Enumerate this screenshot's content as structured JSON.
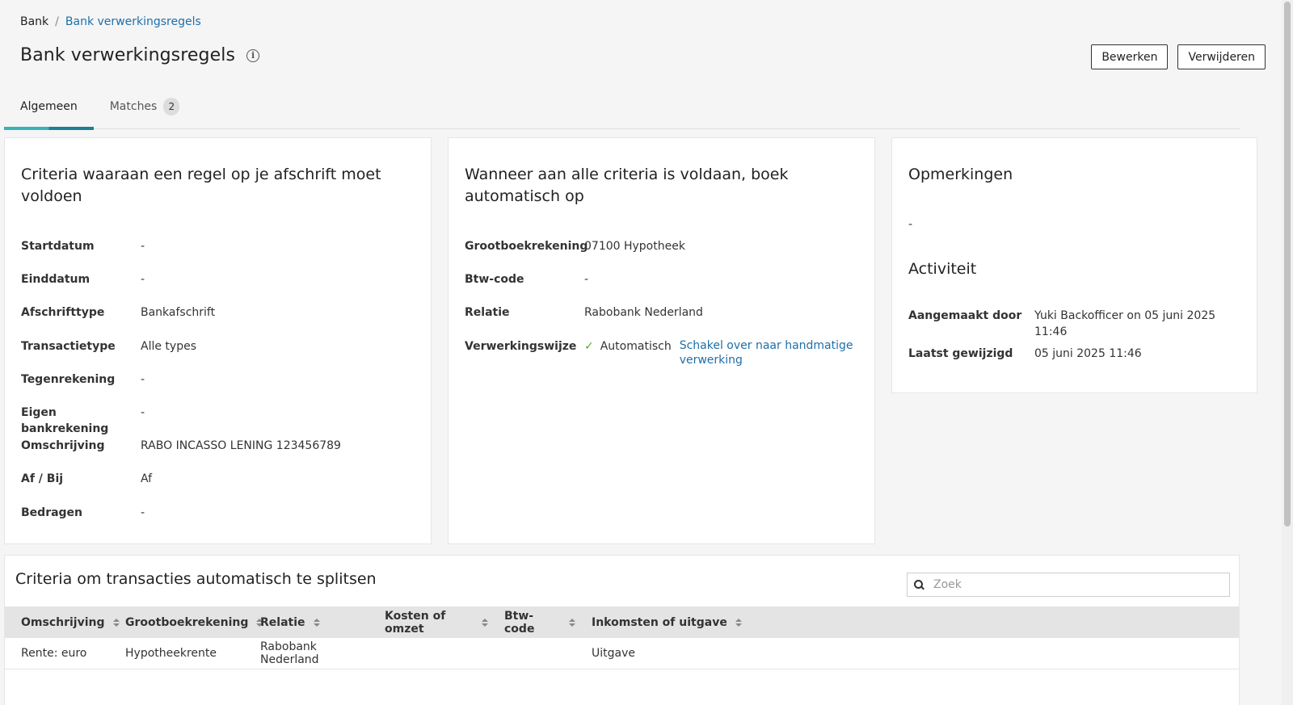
{
  "breadcrumb": {
    "root": "Bank",
    "separator": "/",
    "current": "Bank verwerkingsregels"
  },
  "header": {
    "title": "Bank verwerkingsregels",
    "info_icon": "i"
  },
  "actions": {
    "edit_label": "Bewerken",
    "delete_label": "Verwijderen"
  },
  "tabs": [
    {
      "label": "Algemeen",
      "active": true
    },
    {
      "label": "Matches",
      "badge": "2",
      "active": false
    }
  ],
  "criteria_card": {
    "title": "Criteria waaraan een regel op je afschrift moet voldoen",
    "rows": [
      {
        "key": "Startdatum",
        "value": "-"
      },
      {
        "key": "Einddatum",
        "value": "-"
      },
      {
        "key": "Afschrifttype",
        "value": "Bankafschrift"
      },
      {
        "key": "Transactietype",
        "value": "Alle types"
      },
      {
        "key": "Tegenrekening",
        "value": "-"
      },
      {
        "key": "Eigen bankrekening",
        "value": "-"
      },
      {
        "key": "Omschrijving",
        "value": "RABO INCASSO LENING 123456789"
      },
      {
        "key": "Af / Bij",
        "value": "Af"
      },
      {
        "key": "Bedragen",
        "value": "-"
      }
    ]
  },
  "booking_card": {
    "title": "Wanneer aan alle criteria is voldaan, boek automatisch op",
    "rows": [
      {
        "key": "Grootboekrekening",
        "value": "07100 Hypotheek"
      },
      {
        "key": "Btw-code",
        "value": "-"
      },
      {
        "key": "Relatie",
        "value": "Rabobank Nederland"
      }
    ],
    "processing": {
      "key": "Verwerkingswijze",
      "check": "✓",
      "value": "Automatisch",
      "link": "Schakel over naar handmatige verwerking"
    }
  },
  "remarks_card": {
    "title": "Opmerkingen",
    "value": "-",
    "activity_title": "Activiteit",
    "rows": [
      {
        "key": "Aangemaakt door",
        "value": "Yuki Backofficer on 05 juni 2025 11:46"
      },
      {
        "key": "Laatst gewijzigd",
        "value": "05 juni 2025 11:46"
      }
    ]
  },
  "split_card": {
    "title": "Criteria om transacties automatisch te splitsen",
    "search_placeholder": "Zoek",
    "columns": [
      "Omschrijving",
      "Grootboekrekening",
      "Relatie",
      "Kosten of omzet",
      "Btw-code",
      "Inkomsten of uitgave"
    ],
    "rows": [
      [
        "Rente: euro",
        "Hypotheekrente",
        "Rabobank Nederland",
        "",
        "",
        "Uitgave"
      ]
    ]
  },
  "colors": {
    "link": "#1e6fa8",
    "tab_accent": "#3ab0b9",
    "tab_accent_dark": "#1d7f93",
    "check": "#5aa832"
  }
}
